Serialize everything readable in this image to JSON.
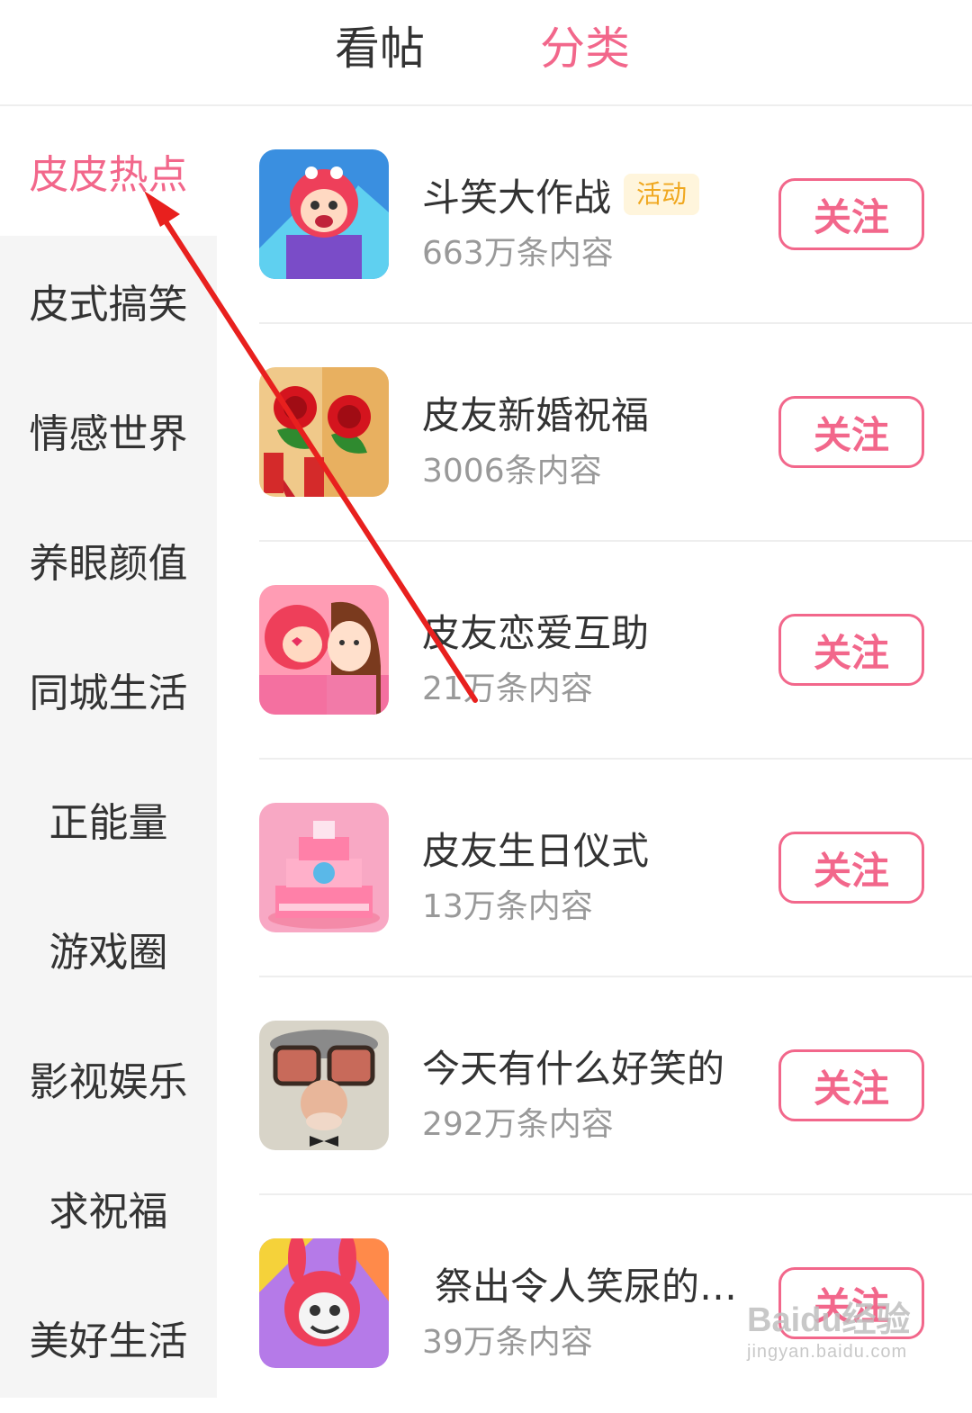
{
  "header": {
    "tabs": [
      {
        "label": "看帖"
      },
      {
        "label": "分类"
      }
    ],
    "active_color": "#f2678b"
  },
  "sidebar": {
    "items": [
      {
        "label": "皮皮热点"
      },
      {
        "label": "皮式搞笑"
      },
      {
        "label": "情感世界"
      },
      {
        "label": "养眼颜值"
      },
      {
        "label": "同城生活"
      },
      {
        "label": "正能量"
      },
      {
        "label": "游戏圈"
      },
      {
        "label": "影视娱乐"
      },
      {
        "label": "求祝福"
      },
      {
        "label": "美好生活"
      }
    ],
    "active_index": 0
  },
  "topics": [
    {
      "title": "斗笑大作战",
      "badge": "活动",
      "count": "663万条内容",
      "follow_label": "关注",
      "thumb_icon": "cartoon-mascot-icon"
    },
    {
      "title": "皮友新婚祝福",
      "count": "3006条内容",
      "follow_label": "关注",
      "thumb_icon": "red-roses-icon"
    },
    {
      "title": "皮友恋爱互助",
      "count": "21万条内容",
      "follow_label": "关注",
      "thumb_icon": "couple-kiss-icon"
    },
    {
      "title": "皮友生日仪式",
      "count": "13万条内容",
      "follow_label": "关注",
      "thumb_icon": "birthday-cake-icon"
    },
    {
      "title": "今天有什么好笑的",
      "count": "292万条内容",
      "follow_label": "关注",
      "thumb_icon": "funny-glasses-face-icon"
    },
    {
      "title": "祭出令人笑尿的…",
      "count": "39万条内容",
      "follow_label": "关注",
      "thumb_icon": "bunny-mascot-icon"
    }
  ],
  "watermark": {
    "brand": "Baidu经验",
    "url": "jingyan.baidu.com"
  },
  "colors": {
    "accent": "#f2678b",
    "badge_text": "#f0a820",
    "badge_bg": "#fff5dc",
    "arrow": "#e8201e"
  }
}
